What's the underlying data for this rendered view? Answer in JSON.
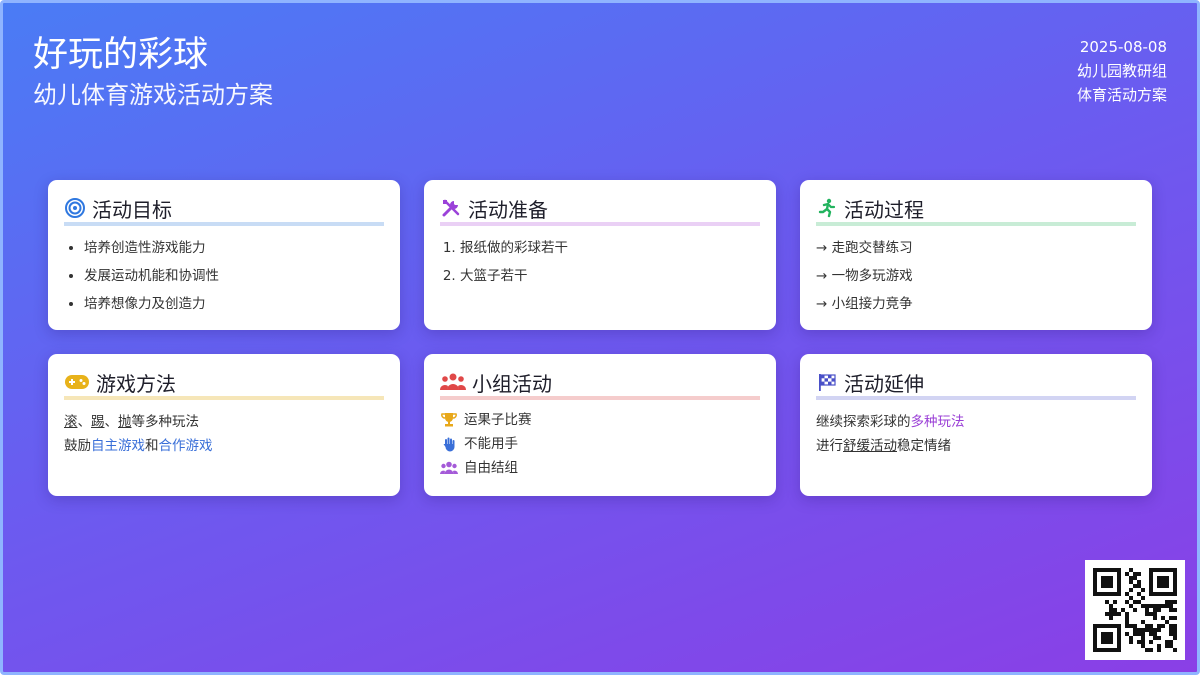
{
  "header": {
    "title": "好玩的彩球",
    "subtitle": "幼儿体育游戏活动方案",
    "date": "2025-08-08",
    "org": "幼儿园教研组",
    "doc_type": "体育活动方案"
  },
  "cards": {
    "goals": {
      "title": "活动目标",
      "icon": "target-icon",
      "items": [
        "培养创造性游戏能力",
        "发展运动机能和协调性",
        "培养想像力及创造力"
      ]
    },
    "prep": {
      "title": "活动准备",
      "icon": "tools-icon",
      "items": [
        "报纸做的彩球若干",
        "大篮子若干"
      ]
    },
    "process": {
      "title": "活动过程",
      "icon": "running-person-icon",
      "items": [
        "→ 走跑交替练习",
        "→ 一物多玩游戏",
        "→ 小组接力竞争"
      ]
    },
    "method": {
      "title": "游戏方法",
      "icon": "gamepad-icon",
      "line1": {
        "a": "滚",
        "sep1": "、",
        "b": "踢",
        "sep2": "、",
        "c": "抛",
        "rest": "等多种玩法"
      },
      "line2": {
        "pre": "鼓励",
        "a": "自主游戏",
        "mid": "和",
        "b": "合作游戏"
      }
    },
    "group": {
      "title": "小组活动",
      "icon": "group-icon",
      "items": [
        {
          "icon": "trophy-icon",
          "text": "运果子比赛"
        },
        {
          "icon": "hand-icon",
          "text": "不能用手"
        },
        {
          "icon": "users-icon",
          "text": "自由结组"
        }
      ]
    },
    "extension": {
      "title": "活动延伸",
      "icon": "checkered-flag-icon",
      "line1": {
        "pre": "继续探索彩球的",
        "hl": "多种玩法"
      },
      "line2": {
        "pre": "进行",
        "hl": "舒缓活动",
        "post": "稳定情绪"
      }
    }
  },
  "colors": {
    "bg_start": "#4a7cf5",
    "bg_end": "#8a3fe6",
    "goals_line": "#c8dcf5",
    "prep_line": "#ead0f5",
    "process_line": "#c8ecd6",
    "method_line": "#f6e6b8",
    "group_line": "#f5cccc",
    "extension_line": "#d2d4f3"
  },
  "qr": {
    "icon": "qr-code-icon"
  }
}
